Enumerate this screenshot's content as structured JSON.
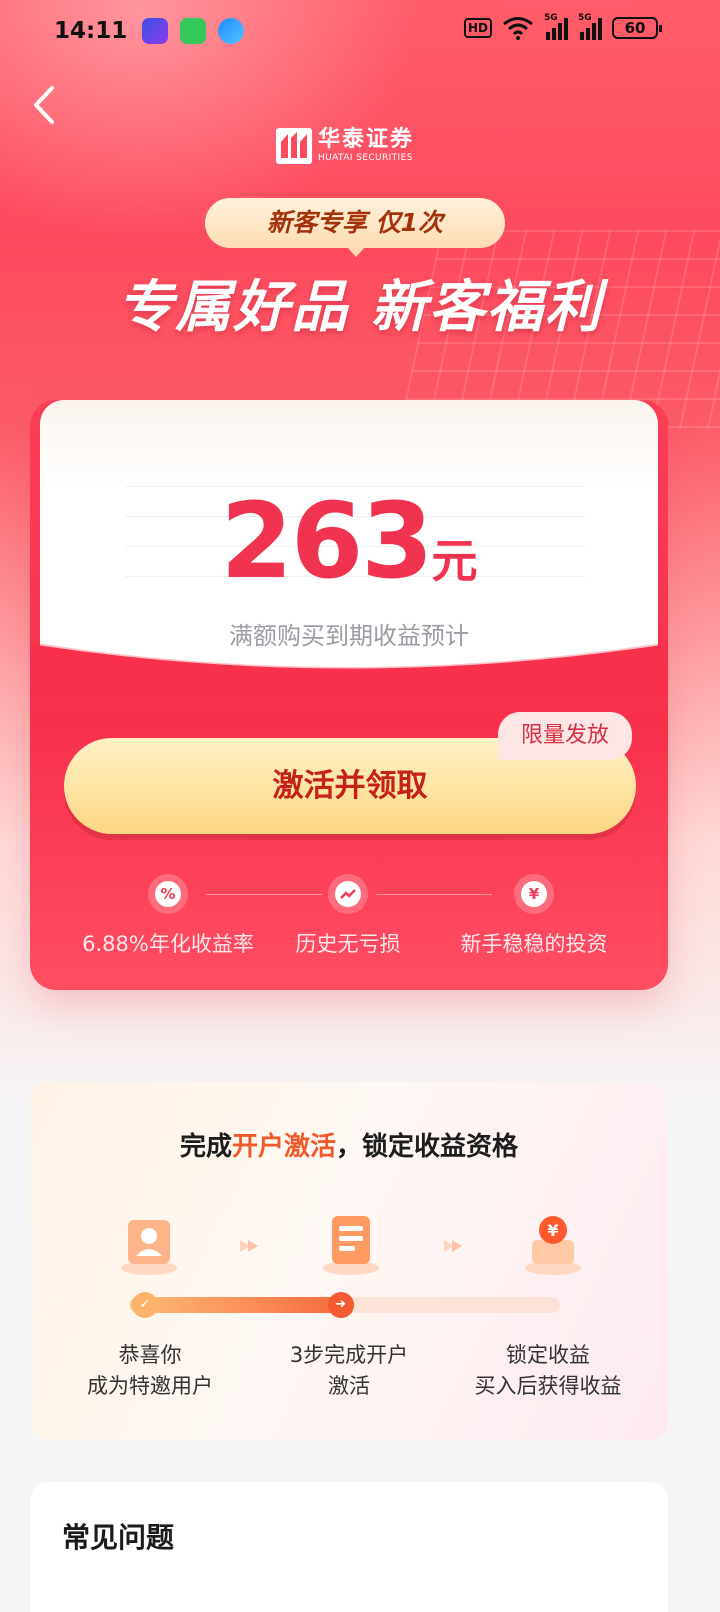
{
  "status_bar": {
    "time": "14:11",
    "hd_label": "HD",
    "network_1": "5G",
    "network_2": "5G",
    "battery": "60"
  },
  "brand": {
    "name_cn": "华泰证券",
    "name_en": "HUATAI SECURITIES"
  },
  "promo": {
    "tag": "新客专享  仅1次",
    "headline": "专属好品 新客福利"
  },
  "card": {
    "amount": "263",
    "amount_unit": "元",
    "amount_desc": "满额购买到期收益预计",
    "badge": "限量发放",
    "cta_label": "激活并领取",
    "features": [
      {
        "icon": "percent-icon",
        "label": "6.88%年化收益率"
      },
      {
        "icon": "chart-up-icon",
        "label": "历史无亏损"
      },
      {
        "icon": "money-bag-icon",
        "label": "新手稳稳的投资"
      }
    ]
  },
  "steps": {
    "title_pre": "完成",
    "title_highlight": "开户激活",
    "title_post": "，锁定收益资格",
    "items": [
      {
        "line1": "恭喜你",
        "line2": "成为特邀用户",
        "icon": "user-card-icon"
      },
      {
        "line1": "3步完成开户",
        "line2": "激活",
        "icon": "form-icon"
      },
      {
        "line1": "锁定收益",
        "line2": "买入后获得收益",
        "icon": "yuan-coin-icon"
      }
    ],
    "progress_fraction": 0.52
  },
  "faq": {
    "title": "常见问题"
  },
  "colors": {
    "brand_red": "#f8304c",
    "cta_text": "#c5231a",
    "highlight_orange": "#f05a2a"
  }
}
